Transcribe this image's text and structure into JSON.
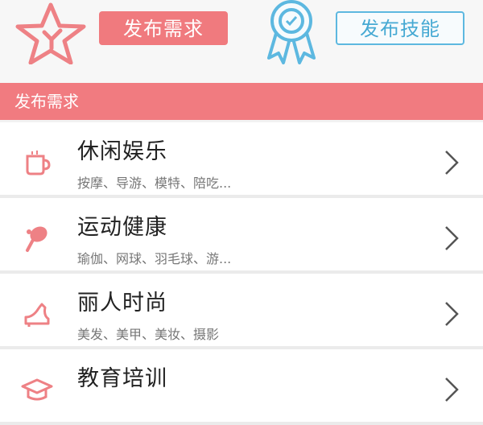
{
  "header": {
    "post_demand_button": "发布需求",
    "post_skill_button": "发布技能",
    "left_icon": "star-icon",
    "right_icon": "medal-ribbon-icon"
  },
  "section": {
    "title": "发布需求"
  },
  "categories": [
    {
      "title": "休闲娱乐",
      "subtitle": "按摩、导游、模特、陪吃...",
      "icon": "cup-icon"
    },
    {
      "title": "运动健康",
      "subtitle": "瑜伽、网球、羽毛球、游...",
      "icon": "racket-icon"
    },
    {
      "title": "丽人时尚",
      "subtitle": "美发、美甲、美妆、摄影",
      "icon": "high-heel-icon"
    },
    {
      "title": "教育培训",
      "subtitle": "",
      "icon": "graduation-cap-icon"
    }
  ],
  "colors": {
    "accent_pink": "#f07a7e",
    "accent_blue": "#5db8e0",
    "background": "#f2f2f2"
  }
}
